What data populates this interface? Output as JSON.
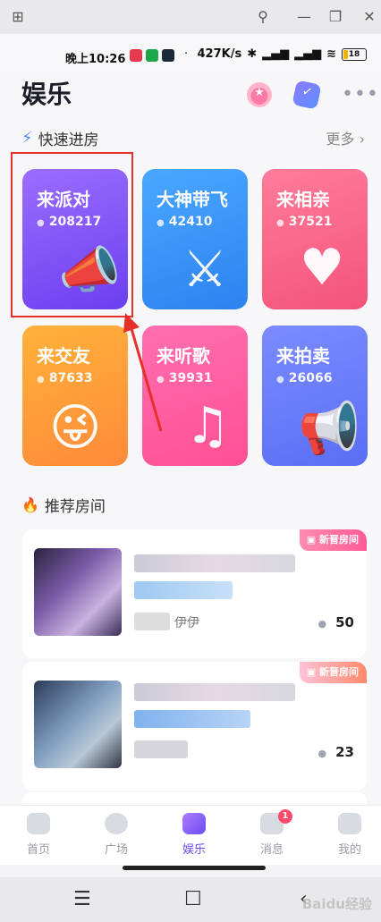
{
  "status_bar": {
    "time": "晚上10:26",
    "speed": "427K/s",
    "battery": "18"
  },
  "header": {
    "title": "娱乐"
  },
  "quick_section": {
    "title": "快速进房",
    "more": "更多 ›"
  },
  "cards": [
    {
      "name": "来派对",
      "count": "208217",
      "art": "📣"
    },
    {
      "name": "大神带飞",
      "count": "42410",
      "art": "⚔"
    },
    {
      "name": "来相亲",
      "count": "37521",
      "art": "♥"
    },
    {
      "name": "来交友",
      "count": "87633",
      "art": "😜"
    },
    {
      "name": "来听歌",
      "count": "39931",
      "art": "♫"
    },
    {
      "name": "来拍卖",
      "count": "26066",
      "art": "📢"
    }
  ],
  "recommend_section": {
    "title": "推荐房间"
  },
  "rooms": [
    {
      "tag": "新晋房间",
      "sub": "伊伊",
      "views": "50"
    },
    {
      "tag": "新晋房间",
      "sub": "",
      "views": "23"
    }
  ],
  "nav": {
    "items": [
      "首页",
      "广场",
      "娱乐",
      "消息",
      "我的"
    ],
    "badge": "1"
  },
  "sys_nav": {
    "menu": "☰",
    "home": "☐",
    "back": "‹"
  },
  "watermark": "Baidu经验"
}
